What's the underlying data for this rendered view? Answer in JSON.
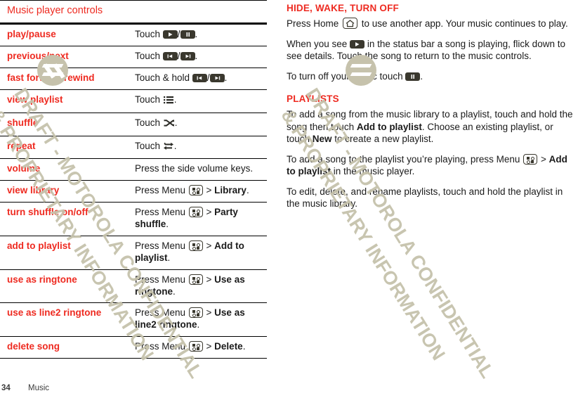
{
  "watermark": {
    "line1": "DRAFT - MOTOROLA CONFIDENTIAL",
    "line2": "& PROPRIETARY INFORMATION",
    "logo": "motorola-m-logo"
  },
  "table": {
    "caption": "Music player controls",
    "rows": [
      {
        "term": "play/pause",
        "prefix": "Touch ",
        "icons": [
          "play-button-icon",
          "pause-button-icon"
        ],
        "separator": "/",
        "suffix": "."
      },
      {
        "term": "previous/next",
        "prefix": "Touch ",
        "icons": [
          "previous-track-icon",
          "next-track-icon"
        ],
        "separator": "/",
        "suffix": "."
      },
      {
        "term": "fast forward/rewind",
        "prefix": "Touch & hold ",
        "icons": [
          "rewind-icon",
          "fast-forward-icon"
        ],
        "separator": "/",
        "suffix": "."
      },
      {
        "term": "view playlist",
        "prefix": "Touch ",
        "icons": [
          "playlist-list-icon"
        ],
        "separator": "",
        "suffix": "."
      },
      {
        "term": "shuffle",
        "prefix": "Touch ",
        "icons": [
          "shuffle-icon"
        ],
        "separator": "",
        "suffix": "."
      },
      {
        "term": "repeat",
        "prefix": "Touch ",
        "icons": [
          "repeat-icon"
        ],
        "separator": "",
        "suffix": "."
      },
      {
        "term": "volume",
        "prefix": "Press the side volume keys.",
        "icons": [],
        "separator": "",
        "suffix": ""
      },
      {
        "term": "view library",
        "prefix": "Press Menu ",
        "icons": [
          "menu-key-icon"
        ],
        "separator": "",
        "mid": " > ",
        "bold": "Library",
        "suffix": "."
      },
      {
        "term": "turn shuffle on/off",
        "prefix": "Press Menu ",
        "icons": [
          "menu-key-icon"
        ],
        "separator": "",
        "mid": " > ",
        "bold": "Party shuffle",
        "suffix": "."
      },
      {
        "term": "add to playlist",
        "prefix": "Press Menu ",
        "icons": [
          "menu-key-icon"
        ],
        "separator": "",
        "mid": " > ",
        "bold": "Add to playlist",
        "suffix": "."
      },
      {
        "term": "use as ringtone",
        "prefix": "Press Menu ",
        "icons": [
          "menu-key-icon"
        ],
        "separator": "",
        "mid": " > ",
        "bold": "Use as ringtone",
        "suffix": "."
      },
      {
        "term": "use as line2 ringtone",
        "prefix": "Press Menu ",
        "icons": [
          "menu-key-icon"
        ],
        "separator": "",
        "mid": " > ",
        "bold": "Use as line2 ringtone",
        "suffix": "."
      },
      {
        "term": "delete song",
        "prefix": "Press Menu ",
        "icons": [
          "menu-key-icon"
        ],
        "separator": "",
        "mid": " > ",
        "bold": "Delete",
        "suffix": "."
      }
    ]
  },
  "right": {
    "section1_title": "Hide, wake, turn off",
    "p1_a": "Press Home ",
    "p1_b": " to use another app. Your music continues to play.",
    "p2_a": "When you see ",
    "p2_b": " in the status bar a song is playing, flick down to see details. Touch the song to return to the music controls.",
    "p3_a": "To turn off your music touch ",
    "p3_b": ".",
    "section2_title": "Playlists",
    "p4_a": "To add a song from the music library to a playlist, touch and hold the song then touch ",
    "p4_bold1": "Add to playlist",
    "p4_b": ". Choose an existing playlist, or touch ",
    "p4_bold2": "New",
    "p4_c": " to create a new playlist.",
    "p5_a": "To add a song to the playlist you’re playing, press Menu ",
    "p5_mid": " > ",
    "p5_bold": "Add to playlist",
    "p5_b": " in the music player.",
    "p6": "To edit, delete, and rename playlists, touch and hold the playlist in the music library."
  },
  "footer": {
    "page": "34",
    "chapter": "Music"
  },
  "colors": {
    "accent_red": "#ee2a20",
    "icon_dark": "#3a382e",
    "watermark": "#c6c2ac",
    "text": "#1a1a1a"
  }
}
